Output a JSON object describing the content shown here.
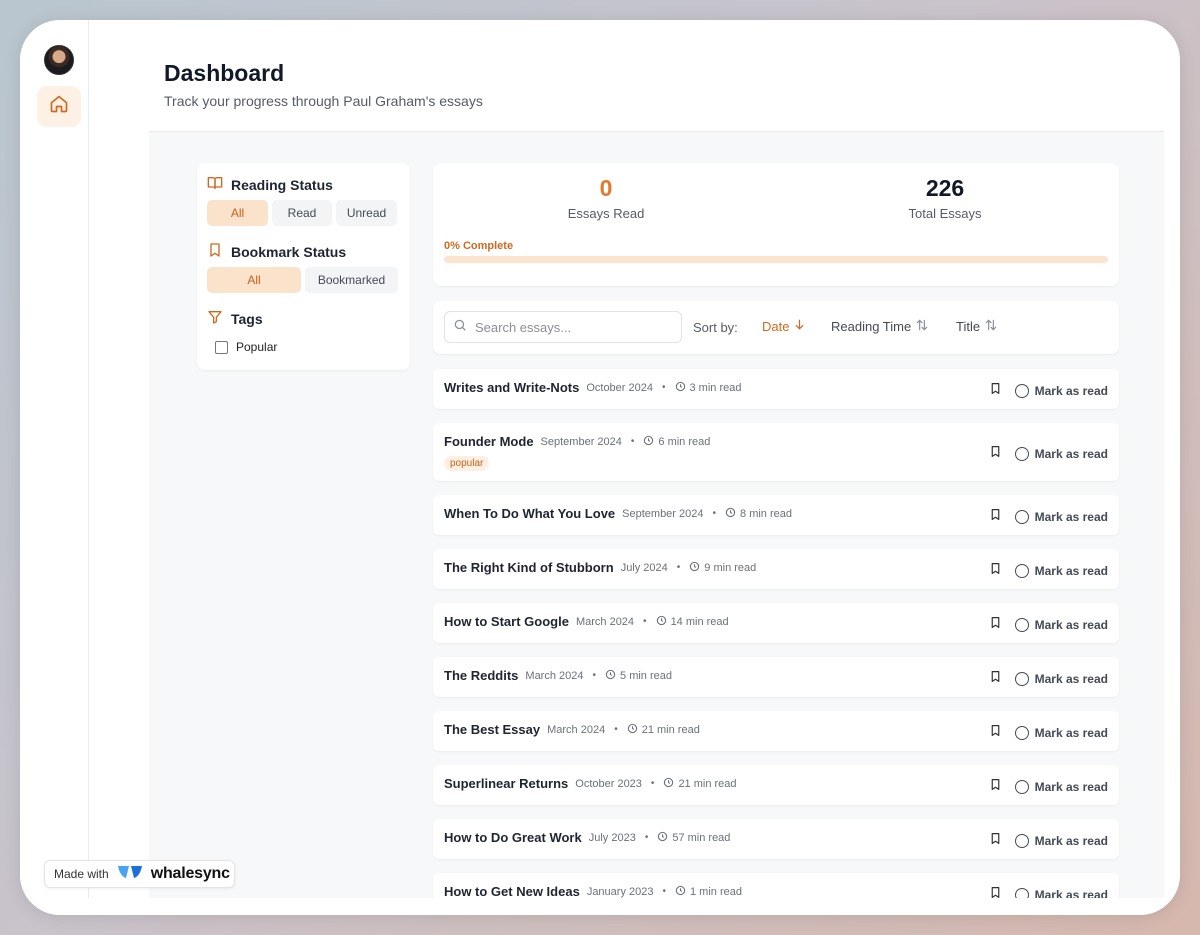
{
  "header": {
    "title": "Dashboard",
    "subtitle": "Track your progress through Paul Graham's essays"
  },
  "sidebar": {
    "home_icon": "home-icon"
  },
  "filters": {
    "reading_status": {
      "title": "Reading Status",
      "options": [
        "All",
        "Read",
        "Unread"
      ],
      "selected": "All"
    },
    "bookmark_status": {
      "title": "Bookmark Status",
      "options": [
        "All",
        "Bookmarked"
      ],
      "selected": "All"
    },
    "tags": {
      "title": "Tags",
      "items": [
        {
          "label": "Popular",
          "checked": false
        }
      ]
    }
  },
  "stats": {
    "essays_read": "0",
    "essays_read_label": "Essays Read",
    "total_essays": "226",
    "total_essays_label": "Total Essays",
    "progress_label": "0% Complete",
    "progress_fraction": 0
  },
  "toolbar": {
    "search_placeholder": "Search essays...",
    "sort_label": "Sort by:",
    "sort_options": [
      {
        "label": "Date",
        "active": true,
        "direction": "desc"
      },
      {
        "label": "Reading Time",
        "active": false
      },
      {
        "label": "Title",
        "active": false
      }
    ]
  },
  "essays": [
    {
      "title": "Writes and Write-Nots",
      "date": "October 2024",
      "read_time": "3 min read",
      "tag": null
    },
    {
      "title": "Founder Mode",
      "date": "September 2024",
      "read_time": "6 min read",
      "tag": "popular"
    },
    {
      "title": "When To Do What You Love",
      "date": "September 2024",
      "read_time": "8 min read",
      "tag": null
    },
    {
      "title": "The Right Kind of Stubborn",
      "date": "July 2024",
      "read_time": "9 min read",
      "tag": null
    },
    {
      "title": "How to Start Google",
      "date": "March 2024",
      "read_time": "14 min read",
      "tag": null
    },
    {
      "title": "The Reddits",
      "date": "March 2024",
      "read_time": "5 min read",
      "tag": null
    },
    {
      "title": "The Best Essay",
      "date": "March 2024",
      "read_time": "21 min read",
      "tag": null
    },
    {
      "title": "Superlinear Returns",
      "date": "October 2023",
      "read_time": "21 min read",
      "tag": null
    },
    {
      "title": "How to Do Great Work",
      "date": "July 2023",
      "read_time": "57 min read",
      "tag": null
    },
    {
      "title": "How to Get New Ideas",
      "date": "January 2023",
      "read_time": "1 min read",
      "tag": null
    }
  ],
  "essay_action_label": "Mark as read",
  "badge": {
    "made_with": "Made with",
    "brand": "whalesync"
  },
  "colors": {
    "accent": "#e27a2e",
    "accent_soft": "#fbe2cb"
  }
}
